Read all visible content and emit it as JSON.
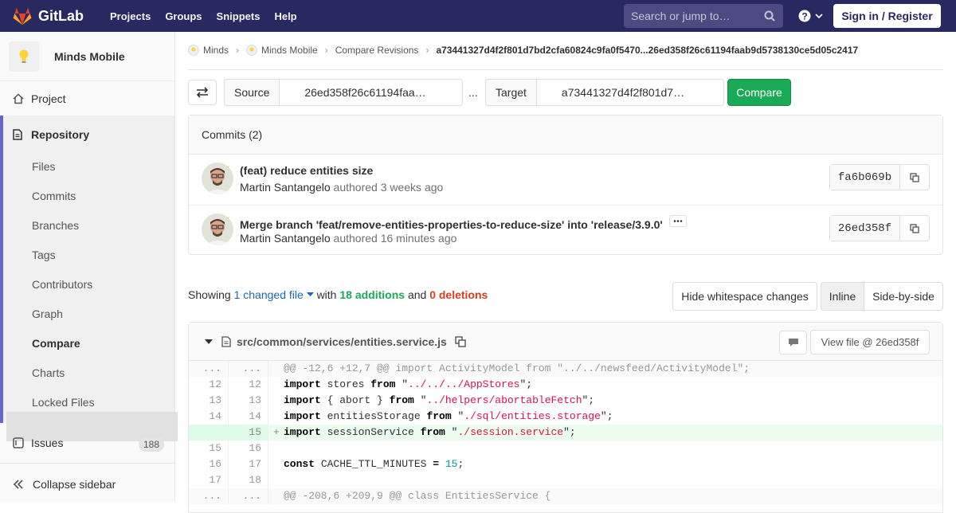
{
  "topbar": {
    "brand": "GitLab",
    "nav": [
      "Projects",
      "Groups",
      "Snippets",
      "Help"
    ],
    "search_placeholder": "Search or jump to…",
    "signin_label": "Sign in / Register",
    "bg_color": "#292961"
  },
  "sidebar": {
    "project_name": "Minds Mobile",
    "project_label": "Project",
    "repository_label": "Repository",
    "repo_items": [
      "Files",
      "Commits",
      "Branches",
      "Tags",
      "Contributors",
      "Graph",
      "Compare",
      "Charts",
      "Locked Files"
    ],
    "active_item": "Compare",
    "issues_label": "Issues",
    "issues_count": "188",
    "collapse_label": "Collapse sidebar",
    "accent_color": "#6666c4"
  },
  "breadcrumb": {
    "items": [
      "Minds",
      "Minds Mobile",
      "Compare Revisions"
    ],
    "current": "a73441327d4f2f801d7bd2cfa60824c9fa0f5470...26ed358f26c61194faab9d5738130ce5d05c2417"
  },
  "compare": {
    "source_label": "Source",
    "source_value": "26ed358f26c61194faa…",
    "separator": "...",
    "target_label": "Target",
    "target_value": "a73441327d4f2f801d7…",
    "button_label": "Compare",
    "button_color": "#1aaa55"
  },
  "commits": {
    "header": "Commits (2)",
    "rows": [
      {
        "title": "(feat) reduce entities size",
        "author": "Martin Santangelo",
        "meta": "authored 3 weeks ago",
        "sha": "fa6b069b"
      },
      {
        "title": "Merge branch 'feat/remove-entities-properties-to-reduce-size' into 'release/3.9.0'",
        "author": "Martin Santangelo",
        "meta": "authored 16 minutes ago",
        "sha": "26ed358f"
      }
    ]
  },
  "summary": {
    "showing": "Showing",
    "changed": "1 changed file",
    "with": "with",
    "additions": "18 additions",
    "and": "and",
    "deletions": "0 deletions",
    "hide_ws_label": "Hide whitespace changes",
    "inline_label": "Inline",
    "side_label": "Side-by-side"
  },
  "file": {
    "path": "src/common/services/entities.service.js",
    "view_label": "View file @ 26ed358f",
    "lines": [
      {
        "type": "match",
        "old": "...",
        "new": "...",
        "code": "@@ -12,6 +12,7 @@ import ActivityModel from \"../../newsfeed/ActivityModel\";"
      },
      {
        "type": "ctx",
        "old": "12",
        "new": "12",
        "code": "import stores from \"../../../AppStores\";"
      },
      {
        "type": "ctx",
        "old": "13",
        "new": "13",
        "code": "import { abort } from \"../helpers/abortableFetch\";"
      },
      {
        "type": "ctx",
        "old": "14",
        "new": "14",
        "code": "import entitiesStorage from \"./sql/entities.storage\";"
      },
      {
        "type": "add",
        "old": "",
        "new": "15",
        "code": "import sessionService from \"./session.service\";"
      },
      {
        "type": "ctx",
        "old": "15",
        "new": "16",
        "code": ""
      },
      {
        "type": "ctx",
        "old": "16",
        "new": "17",
        "code": "const CACHE_TTL_MINUTES = 15;"
      },
      {
        "type": "ctx",
        "old": "17",
        "new": "18",
        "code": ""
      },
      {
        "type": "match",
        "old": "...",
        "new": "...",
        "code": "@@ -208,6 +209,9 @@ class EntitiesService {"
      }
    ]
  }
}
